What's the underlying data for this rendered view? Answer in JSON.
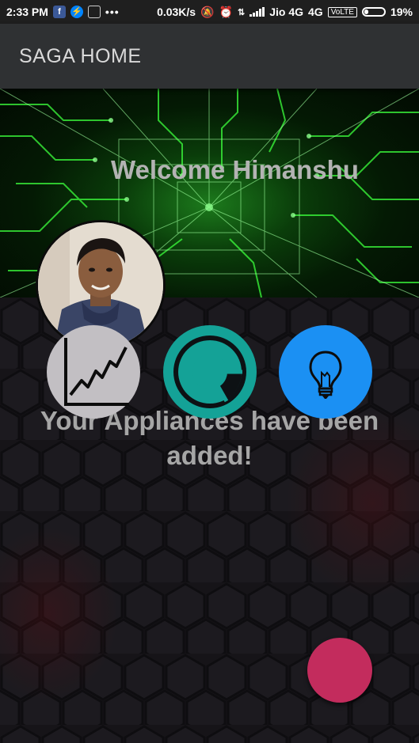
{
  "status_bar": {
    "time": "2:33 PM",
    "network_speed": "0.03K/s",
    "carrier": "Jio 4G",
    "network_type": "4G",
    "volte": "VoLTE",
    "battery_level": 0.19,
    "battery_text": "19%",
    "notification_icons": [
      "facebook-icon",
      "messenger-icon",
      "app-icon",
      "more-icon"
    ],
    "system_icons": [
      "mute-icon",
      "alarm-icon",
      "data-icon",
      "signal-icon",
      "battery-icon"
    ]
  },
  "app_bar": {
    "title": "SAGA HOME"
  },
  "banner": {
    "welcome_text": "Welcome Himanshu"
  },
  "actions": [
    {
      "icon": "line-chart-icon",
      "color": "#c2bfc3"
    },
    {
      "icon": "ring-chart-icon",
      "color": "#14a297"
    },
    {
      "icon": "lightbulb-icon",
      "color": "#1b90f3"
    }
  ],
  "message": {
    "text": "Your Appliances have been added!"
  },
  "fab": {
    "color": "#c32c5d"
  },
  "colors": {
    "app_bar": "#2f3133",
    "background": "#161418",
    "accent_green": "#39e639"
  }
}
